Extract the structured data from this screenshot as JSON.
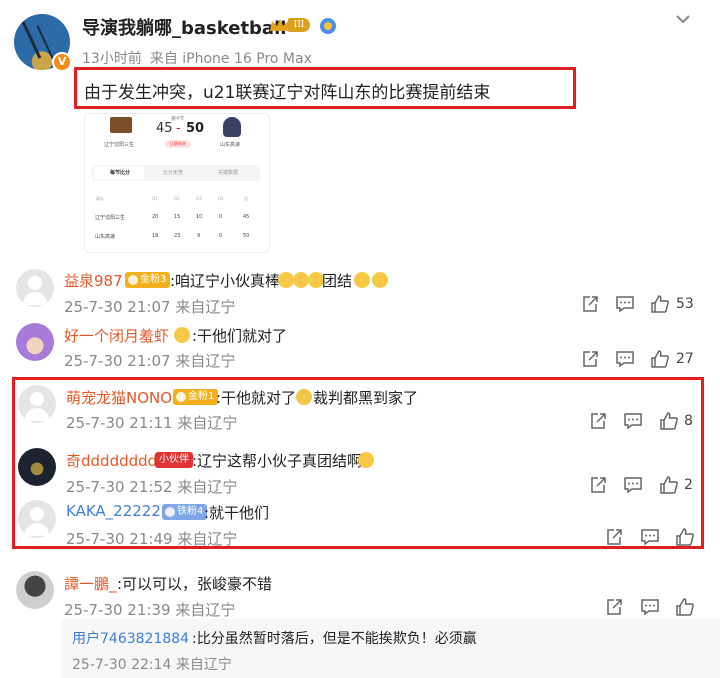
{
  "post": {
    "author": "导演我躺哪_basketball",
    "level_badge": "III",
    "time": "13小时前",
    "source": "来自 iPhone 16 Pro Max",
    "text": "由于发生冲突，u21联赛辽宁对阵山东的比赛提前结束",
    "verified_badge": "V",
    "accent_color": "#e02020"
  },
  "scoreboard": {
    "period": "第4节",
    "team_left": "辽宁沈阳三生",
    "team_right": "山东高速",
    "score_left": "45",
    "score_right": "50",
    "status": "比赛结束",
    "tabs": [
      "每节比分",
      "比分走势",
      "关键数据"
    ],
    "headers": [
      "球队",
      "Q1",
      "Q2",
      "Q3",
      "Q4",
      "总"
    ],
    "rows": [
      {
        "team": "辽宁沈阳三生",
        "q1": "20",
        "q2": "15",
        "q3": "10",
        "q4": "0",
        "total": "45"
      },
      {
        "team": "山东高速",
        "q1": "18",
        "q2": "23",
        "q3": "9",
        "q4": "0",
        "total": "50"
      }
    ]
  },
  "comments": [
    {
      "name": "益泉987",
      "badge": "金粉3",
      "text": ":咱辽宁小伙真棒",
      "text2": "团结",
      "date": "25-7-30 21:07",
      "loc": "来自辽宁",
      "likes": "53"
    },
    {
      "name": "好一个闭月羞虾",
      "text": ":干他们就对了",
      "date": "25-7-30 21:07",
      "loc": "来自辽宁",
      "likes": "27"
    },
    {
      "name": "萌宠龙猫NONO",
      "badge": "金粉1",
      "text": ":干他就对了",
      "text2": "裁判都黑到家了",
      "date": "25-7-30 21:11",
      "loc": "来自辽宁",
      "likes": "8"
    },
    {
      "name": "奇dddddddd",
      "tag": "小伙伴",
      "text": ":辽宁这帮小伙子真团结啊",
      "date": "25-7-30 21:52",
      "loc": "来自辽宁",
      "likes": "2"
    },
    {
      "name": "KAKA_22222",
      "badge": "铁粉4",
      "text": ":就干他们",
      "date": "25-7-30 21:49",
      "loc": "来自辽宁",
      "likes": ""
    },
    {
      "name": "譚一鵬_",
      "text": ":可以可以，张峻豪不错",
      "date": "25-7-30 21:39",
      "loc": "来自辽宁",
      "likes": ""
    }
  ],
  "reply": {
    "name": "用户7463821884",
    "text": ":比分虽然暂时落后，但是不能挨欺负！必须赢",
    "date": "25-7-30 22:14",
    "loc": "来自辽宁"
  },
  "icons": [
    "share-icon",
    "comment-icon",
    "like-icon",
    "chevron-down-icon"
  ]
}
